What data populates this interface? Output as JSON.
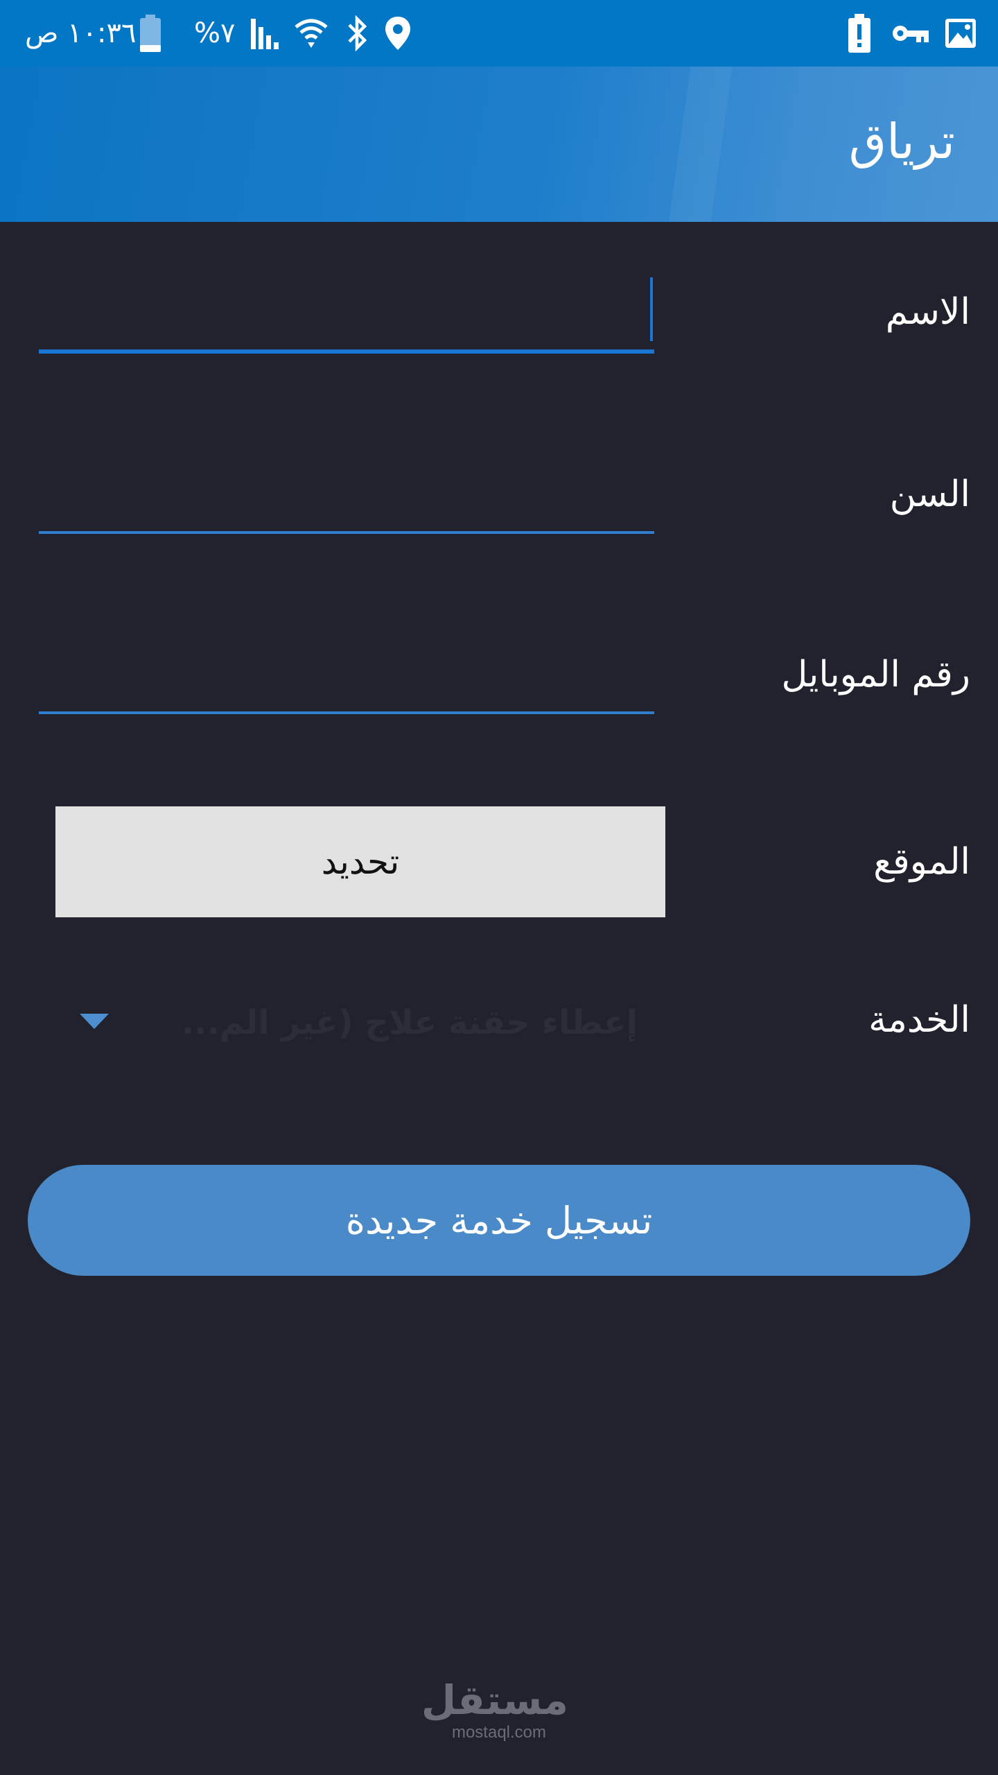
{
  "status_bar": {
    "time": "١٠:٣٦ ص",
    "battery_percent": "%٧",
    "icons_left": [
      "battery-icon",
      "signal-icon",
      "wifi-icon",
      "bluetooth-icon",
      "location-icon"
    ],
    "icons_right": [
      "battery-alert-icon",
      "vpn-key-icon",
      "image-icon"
    ]
  },
  "app_bar": {
    "title": "ترياق"
  },
  "form": {
    "name_label": "الاسم",
    "name_value": "",
    "age_label": "السن",
    "age_value": "",
    "mobile_label": "رقم الموبايل",
    "mobile_value": "",
    "location_label": "الموقع",
    "location_button": "تحديد",
    "service_label": "الخدمة",
    "service_value": "إعطاء حقنة علاج (غير الم..."
  },
  "actions": {
    "submit_label": "تسجيل خدمة جديدة"
  },
  "watermark": {
    "arabic": "مستقل",
    "latin": "mostaql.com"
  },
  "colors": {
    "status_bar": "#0277c6",
    "app_bar": "#2f80cb",
    "background": "#21222e",
    "accent": "#1976d2",
    "submit_button": "#4a8ac8",
    "select_button": "#e1e1e1"
  }
}
